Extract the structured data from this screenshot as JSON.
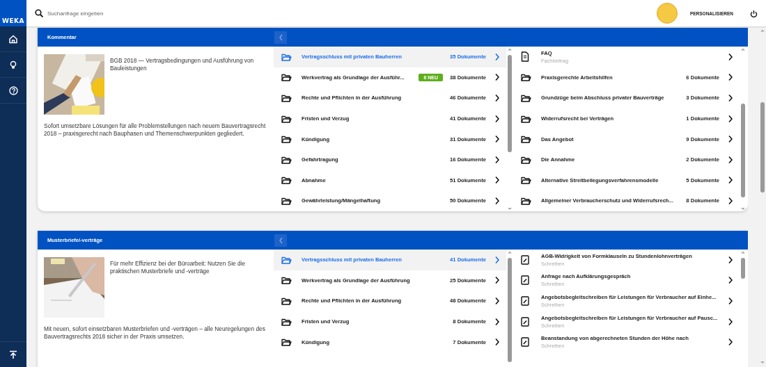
{
  "sidebar": {
    "logo": "WEKA"
  },
  "topbar": {
    "search": {
      "placeholder": "Suchanfrage eingeben"
    },
    "personalize": "PERSONALISIEREN"
  },
  "sections": [
    {
      "title": "Kommentar",
      "lead": "BGB 2018 — Vertragsbedingungen und Ausführung von Bauleistungen",
      "description": "Sofort umsetzbare Lösungen für alle Problemstellungen nach neuem Bauvertragsrecht 2018 – praxisgerecht nach Bauphasen und Themenschwerpunkten gegliedert.",
      "categories": [
        {
          "label": "Vertragsschluss mit privaten Bauherren",
          "count": "35 Dokumente",
          "selected": true
        },
        {
          "label": "Werkvertrag als Grundlage der Ausführ...",
          "badge": "6 NEU",
          "count": "38 Dokumente",
          "selected": false
        },
        {
          "label": "Rechte und Pflichten in der Ausführung",
          "count": "46 Dokumente",
          "selected": false
        },
        {
          "label": "Fristen und Verzug",
          "count": "41 Dokumente",
          "selected": false
        },
        {
          "label": "Kündigung",
          "count": "31 Dokumente",
          "selected": false
        },
        {
          "label": "Gefahrtragung",
          "count": "16 Dokumente",
          "selected": false
        },
        {
          "label": "Abnahme",
          "count": "51 Dokumente",
          "selected": false
        },
        {
          "label": "Gewährleistung/Mängelhaftung",
          "count": "50 Dokumente",
          "selected": false
        }
      ],
      "items": [
        {
          "kind": "article",
          "title": "FAQ",
          "subtitle": "Fachbeitrag"
        },
        {
          "kind": "folder",
          "title": "Praxisgerechte Arbeitshilfen",
          "count": "6 Dokumente"
        },
        {
          "kind": "folder",
          "title": "Grundzüge beim Abschluss privater Bauverträge",
          "count": "3 Dokumente"
        },
        {
          "kind": "folder",
          "title": "Widerrufsrecht bei Verträgen",
          "count": "1 Dokumente"
        },
        {
          "kind": "folder",
          "title": "Das Angebot",
          "count": "9 Dokumente"
        },
        {
          "kind": "folder",
          "title": "Die Annahme",
          "count": "2 Dokumente"
        },
        {
          "kind": "folder",
          "title": "Alternative Streitbeilegungsverfahrensmodelle",
          "count": "5 Dokumente"
        },
        {
          "kind": "folder",
          "title": "Allgemeiner Verbraucherschutz und Widerrufsrech...",
          "count": "8 Dokumente"
        }
      ]
    },
    {
      "title": "Musterbriefe/-verträge",
      "lead": "Für mehr Effizienz bei der Büroarbeit: Nutzen Sie die praktischen Musterbriefe und -verträge",
      "description": "Mit neuen, sofort einsetzbaren Musterbriefen und -verträgen – alle Neuregelungen des Bauvertragsrechts 2018 sicher in der Praxis umsetzen.",
      "categories": [
        {
          "label": "Vertragsschluss mit privaten Bauherren",
          "count": "41 Dokumente",
          "selected": true
        },
        {
          "label": "Werkvertrag als Grundlage der Ausführung",
          "count": "25 Dokumente",
          "selected": false
        },
        {
          "label": "Rechte und Pflichten in der Ausführung",
          "count": "48 Dokumente",
          "selected": false
        },
        {
          "label": "Fristen und Verzug",
          "count": "8 Dokumente",
          "selected": false
        },
        {
          "label": "Kündigung",
          "count": "7 Dokumente",
          "selected": false
        }
      ],
      "items": [
        {
          "kind": "letter",
          "title": "AGB-Widrigkeit von Formklauseln zu Stundenlohnverträgen",
          "subtitle": "Schreiben"
        },
        {
          "kind": "letter",
          "title": "Anfrage nach Aufklärungsgespräch",
          "subtitle": "Schreiben"
        },
        {
          "kind": "letter",
          "title": "Angebotsbegleitschreiben für Leistungen für Verbraucher auf Einhe...",
          "subtitle": "Schreiben"
        },
        {
          "kind": "letter",
          "title": "Angebotsbegleitschreiben für Leistungen für Verbraucher auf Pausc...",
          "subtitle": "Schreiben"
        },
        {
          "kind": "letter",
          "title": "Beanstandung von abgerechneten Stunden der Höhe nach",
          "subtitle": "Schreiben"
        }
      ]
    }
  ]
}
